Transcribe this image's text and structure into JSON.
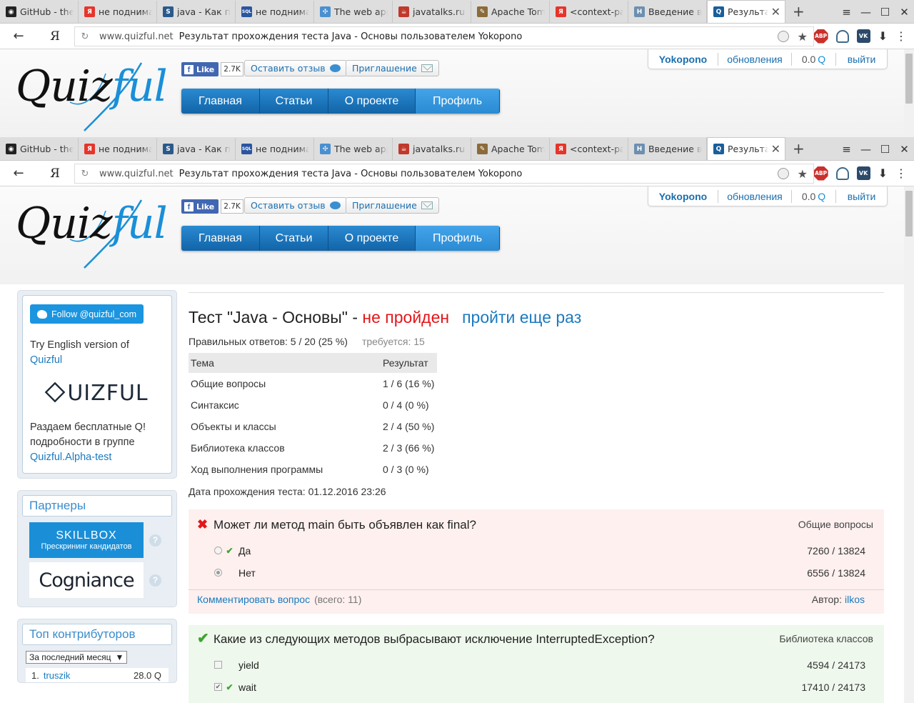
{
  "browser": {
    "tabs": [
      {
        "label": "GitHub - the",
        "fav": "github",
        "fav_color": "#222222",
        "fav_char": "◉"
      },
      {
        "label": "не поднимае",
        "fav": "yandex",
        "fav_color": "#e6352b",
        "fav_char": "Я"
      },
      {
        "label": "java - Как пр",
        "fav": "stackoverflow",
        "fav_color": "#2b5a8a",
        "fav_char": "S"
      },
      {
        "label": "не поднимае",
        "fav": "sqlru",
        "fav_color": "#2a55a0",
        "fav_char": "SQL"
      },
      {
        "label": "The web app",
        "fav": "molecule",
        "fav_color": "#4a90d0",
        "fav_char": "✣"
      },
      {
        "label": "javatalks.ru /",
        "fav": "java",
        "fav_color": "#c0392b",
        "fav_char": "☕"
      },
      {
        "label": "Apache Tomc",
        "fav": "tomcat",
        "fav_color": "#8b6b3a",
        "fav_char": "✎"
      },
      {
        "label": "<context-par",
        "fav": "yandex",
        "fav_color": "#e6352b",
        "fav_char": "Я"
      },
      {
        "label": "Введение в S",
        "fav": "habr",
        "fav_color": "#6d8fb0",
        "fav_char": "H"
      },
      {
        "label": "Результат",
        "fav": "quizful",
        "fav_color": "#1a5e9a",
        "fav_char": "Q",
        "active": true
      }
    ],
    "new_tab": "+",
    "window_controls": [
      "≡",
      "—",
      "☐",
      "✕"
    ],
    "back": "←",
    "yandex_button": "Я",
    "reload": "↻",
    "domain": "www.quizful.net",
    "page_title": "Результат прохождения теста Java - Основы пользователем Yokopono",
    "extensions": {
      "abp": "ABP",
      "vk": "VK"
    }
  },
  "header": {
    "logo_quiz": "Quiz",
    "logo_ful": "ful",
    "fb_like": "Like",
    "fb_count": "2.7K",
    "feedback_button": "Оставить отзыв",
    "invite_button": "Приглашение",
    "nav": [
      {
        "label": "Главная"
      },
      {
        "label": "Статьи"
      },
      {
        "label": "О проекте"
      },
      {
        "label": "Профиль",
        "active": true
      }
    ],
    "user": {
      "name": "Yokopono",
      "updates": "обновления",
      "balance": "0.0",
      "currency": "Q",
      "logout": "выйти"
    }
  },
  "sidebar": {
    "twitter_follow": "Follow @quizful_com",
    "english_text": "Try English version of",
    "english_link": "Quizful",
    "promo_logo": "UIZFUL",
    "promo_text": "Раздаем бесплатные Q! подробности в группе",
    "promo_link": "Quizful.Alpha-test",
    "partners_title": "Партнеры",
    "partners": [
      {
        "name": "SKILLBOX",
        "tagline": "Прескрининг кандидатов"
      },
      {
        "name": "Cogniance",
        "tagline": ""
      }
    ],
    "contributors_title": "Топ контрибуторов",
    "period_select": "За последний месяц",
    "contributor_first": {
      "rank": "1.",
      "name": "truszik",
      "score": "28.0 Q"
    }
  },
  "result": {
    "title_prefix": "Тест \"Java - Основы\" - ",
    "status": "не пройден",
    "retry": "пройти еще раз",
    "correct": "Правильных ответов: 5 / 20 (25 %)",
    "required": "требуется: 15",
    "table_headers": [
      "Тема",
      "Результат"
    ],
    "table_rows": [
      [
        "Общие вопросы",
        "1 / 6 (16 %)"
      ],
      [
        "Синтаксис",
        "0 / 4 (0 %)"
      ],
      [
        "Объекты и классы",
        "2 / 4 (50 %)"
      ],
      [
        "Библиотека классов",
        "2 / 3 (66 %)"
      ],
      [
        "Ход выполнения программы",
        "0 / 3 (0 %)"
      ]
    ],
    "date": "Дата прохождения теста: 01.12.2016 23:26"
  },
  "questions": [
    {
      "text": "Может ли метод main быть объявлен как final?",
      "topic": "Общие вопросы",
      "answers": [
        {
          "label": "Да",
          "count": "7260 / 13824",
          "correct": true,
          "selected": false
        },
        {
          "label": "Нет",
          "count": "6556 / 13824",
          "correct": false,
          "selected": true
        }
      ],
      "comment_link": "Комментировать вопрос",
      "comment_count": "(всего: 11)",
      "author_label": "Автор:",
      "author": "ilkos"
    },
    {
      "text": "Какие из следующих методов выбрасывают исключение InterruptedException?",
      "topic": "Библиотека классов",
      "answers": [
        {
          "label": "yield",
          "count": "4594 / 24173",
          "correct": false,
          "selected": false
        },
        {
          "label": "wait",
          "count": "17410 / 24173",
          "correct": true,
          "selected": true
        }
      ]
    }
  ]
}
